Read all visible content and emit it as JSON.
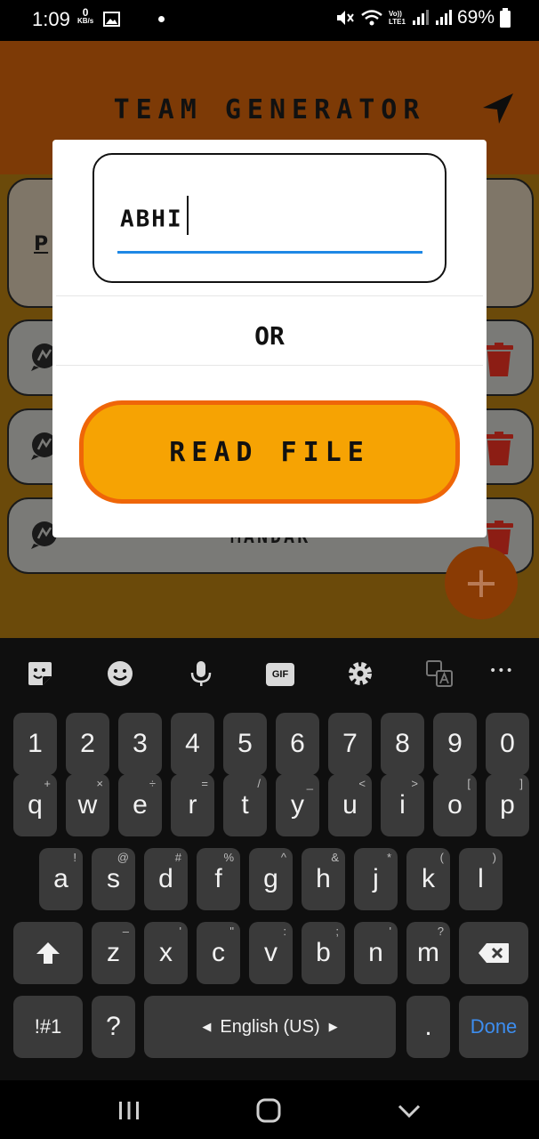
{
  "status_bar": {
    "time": "1:09",
    "net_speed_value": "0",
    "net_speed_unit": "KB/s",
    "volte_top": "Vo))",
    "volte_bottom": "LTE1",
    "battery_percent": "69%"
  },
  "app": {
    "title": "TEAM GENERATOR",
    "accent_color": "#7d3a06"
  },
  "cards": {
    "top_label": "P",
    "players": [
      {
        "name": ""
      },
      {
        "name": ""
      },
      {
        "name": "MANDAR"
      }
    ]
  },
  "fab": {
    "label": "+"
  },
  "dialog": {
    "input_value": "ABHI",
    "or_label": "OR",
    "read_file_label": "READ FILE",
    "button_color": "#f6a303",
    "button_border_color": "#ef6608",
    "underline_color": "#1e88e5"
  },
  "keyboard": {
    "toolbar_icons": [
      "sticker-icon",
      "emoji-icon",
      "mic-icon",
      "gif-icon",
      "settings-icon",
      "translate-icon",
      "more-icon"
    ],
    "gif_label": "GIF",
    "more_label": "•••",
    "number_row": [
      "1",
      "2",
      "3",
      "4",
      "5",
      "6",
      "7",
      "8",
      "9",
      "0"
    ],
    "row1": {
      "keys": [
        "q",
        "w",
        "e",
        "r",
        "t",
        "y",
        "u",
        "i",
        "o",
        "p"
      ],
      "subs": [
        "+",
        "×",
        "÷",
        "=",
        "/",
        "_",
        "<",
        ">",
        "[",
        "]"
      ]
    },
    "row2": {
      "keys": [
        "a",
        "s",
        "d",
        "f",
        "g",
        "h",
        "j",
        "k",
        "l"
      ],
      "subs": [
        "!",
        "@",
        "#",
        "%",
        "^",
        "&",
        "*",
        "(",
        ")"
      ]
    },
    "row3": {
      "keys": [
        "z",
        "x",
        "c",
        "v",
        "b",
        "n",
        "m"
      ],
      "subs": [
        "–",
        "'",
        "\"",
        ":",
        ";",
        "'",
        "?"
      ]
    },
    "symbols_label": "!#1",
    "question_label": "?",
    "space_label": "English (US)",
    "period_label": ".",
    "done_label": "Done",
    "done_color": "#3d8ef0"
  }
}
